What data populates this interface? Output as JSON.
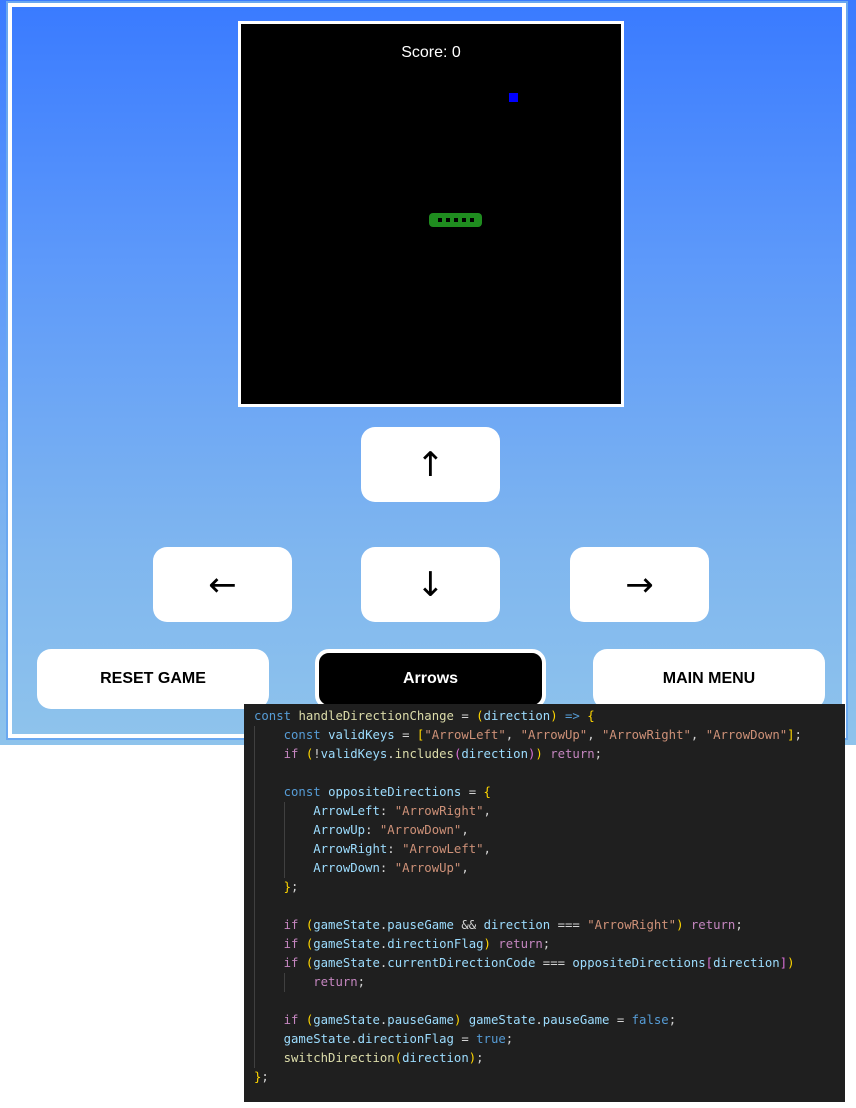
{
  "game": {
    "score_label": "Score: 0",
    "food_color": "#0000ff",
    "snake_color": "#1f8c1f",
    "snake_segments": 5
  },
  "controls": {
    "up": "↑",
    "left": "←",
    "down": "↓",
    "right": "→"
  },
  "menu": {
    "reset_label": "RESET GAME",
    "mode_label": "Arrows",
    "main_menu_label": "MAIN MENU"
  },
  "code": {
    "language": "javascript",
    "lines": [
      "const handleDirectionChange = (direction) => {",
      "    const validKeys = [\"ArrowLeft\", \"ArrowUp\", \"ArrowRight\", \"ArrowDown\"];",
      "    if (!validKeys.includes(direction)) return;",
      "",
      "    const oppositeDirections = {",
      "        ArrowLeft: \"ArrowRight\",",
      "        ArrowUp: \"ArrowDown\",",
      "        ArrowRight: \"ArrowLeft\",",
      "        ArrowDown: \"ArrowUp\",",
      "    };",
      "",
      "    if (gameState.pauseGame && direction === \"ArrowRight\") return;",
      "    if (gameState.directionFlag) return;",
      "    if (gameState.currentDirectionCode === oppositeDirections[direction])",
      "        return;",
      "",
      "    if (gameState.pauseGame) gameState.pauseGame = false;",
      "    gameState.directionFlag = true;",
      "    switchDirection(direction);",
      "};"
    ]
  }
}
